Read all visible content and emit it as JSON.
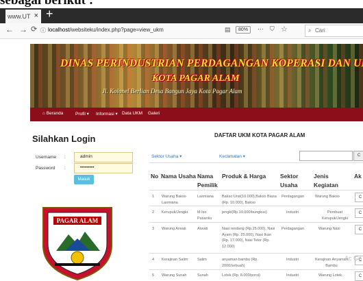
{
  "caption": "sebagai berikut :",
  "browser": {
    "tab_title": "www.UT",
    "url_host": "localhost",
    "url_path": "/websiteku/index.php?page=view_ukm",
    "zoom": "80%",
    "search_placeholder": "Cari"
  },
  "banner": {
    "line1": "DINAS PERINDUSTRIAN PERDAGANGAN KOPERASI DAN UKM",
    "line2": "KOTA PAGAR ALAM",
    "line3": "Jl. Kolonel Berlian Desa Bangun Jaya Kota Pagar Alam"
  },
  "nav": {
    "items": [
      "Beranda",
      "Profil",
      "Informasi",
      "Data UKM",
      "Galeri"
    ]
  },
  "login": {
    "title": "Silahkan Login",
    "username_label": "Username",
    "password_label": "Password",
    "sep": ":",
    "username_value": "admin",
    "password_value": "•••••••••",
    "submit_label": "Masuk"
  },
  "logo_text": "PAGAR ALAM",
  "table": {
    "title": "DAFTAR UKM KOTA PAGAR ALAM",
    "filter_sektor": "Sektor Usaha ▾",
    "filter_kecamatan": "Kecamatan ▾",
    "search_button": "C",
    "headers": {
      "no": "No",
      "nama_usaha": "Nama Usaha",
      "nama_pemilik": "Nama Pemilik",
      "produk": "Produk & Harga",
      "sektor": "Sektor Usaha",
      "jenis": "Jenis Kegiatan",
      "aksi": "Ak"
    },
    "rows": [
      {
        "no": "1",
        "usaha": "Warung Bakso Lasmiana",
        "pemilik": "Lasmiana",
        "produk": "Bakso Urat(10.000),Bakso Biasa (Rp. 10.000), Bakso",
        "sektor": "Perdagangan",
        "jenis": "Warung Bakso",
        "aksi": "C"
      },
      {
        "no": "2",
        "usaha": "Kerupuk/Jengki",
        "pemilik": "M.Iso Pasariku",
        "produk": "jengki(Rp.10.000/bungkus)",
        "sektor": "Industri",
        "jenis": "Pembuat Kerupuk/Jengki",
        "aksi": "C"
      },
      {
        "no": "3",
        "usaha": "Warung Arwati",
        "pemilik": "Arwati",
        "produk": "Nasi rendang (Rp.25.000), Nasi Ayam (Rp. 25.000), Nasi Ikan (Rp. 17.000), Nasi Telor (Rp. 12.000)",
        "sektor": "Perdagangan",
        "jenis": "Warung Nasi",
        "aksi": "C"
      },
      {
        "no": "4",
        "usaha": "Kerajinan Salim",
        "pemilik": "Salim",
        "produk": "anyaman bambu (Rp. 2000/sebuah)",
        "sektor": "Industri",
        "jenis": "Kerajinan Anyaman Bambu",
        "aksi": "C"
      },
      {
        "no": "5",
        "usaha": "Warung Sunah",
        "pemilik": "Sunah",
        "produk": "Lotek (Rp. 8.000/porsi)",
        "sektor": "Industri",
        "jenis": "Warung Lotek",
        "aksi": "C"
      }
    ]
  },
  "watermark": "Ac Go"
}
